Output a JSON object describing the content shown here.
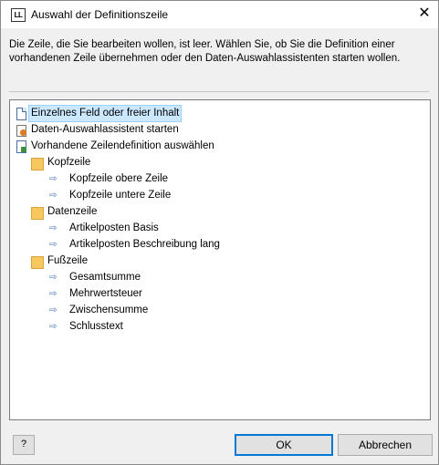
{
  "window": {
    "icon_text": "LL",
    "title": "Auswahl der Definitionszeile",
    "close_glyph": "✕"
  },
  "message": {
    "line1": "Die Zeile, die Sie bearbeiten wollen, ist leer. Wählen Sie, ob Sie die Definition einer",
    "line2": "vorhandenen Zeile übernehmen oder den Daten-Auswahlassistenten starten wollen."
  },
  "tree": {
    "items": [
      {
        "label": "Einzelnes Feld oder freier Inhalt",
        "icon": "document-icon",
        "selected": true
      },
      {
        "label": "Daten-Auswahlassistent starten",
        "icon": "wizard-icon"
      },
      {
        "label": "Vorhandene Zeilendefinition auswählen",
        "icon": "select-definition-icon"
      },
      {
        "label": "Kopfzeile",
        "icon": "folder-icon"
      },
      {
        "label": "Kopfzeile obere Zeile",
        "icon": "arrow-icon"
      },
      {
        "label": "Kopfzeile untere Zeile",
        "icon": "arrow-icon"
      },
      {
        "label": "Datenzeile",
        "icon": "folder-icon"
      },
      {
        "label": "Artikelposten Basis",
        "icon": "arrow-icon"
      },
      {
        "label": "Artikelposten Beschreibung lang",
        "icon": "arrow-icon"
      },
      {
        "label": "Fußzeile",
        "icon": "folder-icon"
      },
      {
        "label": "Gesamtsumme",
        "icon": "arrow-icon"
      },
      {
        "label": "Mehrwertsteuer",
        "icon": "arrow-icon"
      },
      {
        "label": "Zwischensumme",
        "icon": "arrow-icon"
      },
      {
        "label": "Schlusstext",
        "icon": "arrow-icon"
      }
    ],
    "arrow_glyph": "⇨"
  },
  "footer": {
    "help_glyph": "?",
    "ok_label": "OK",
    "cancel_label": "Abbrechen"
  },
  "colors": {
    "selection": "#cce8ff",
    "folder": "#f6c85f",
    "default_button_border": "#0078d7"
  }
}
